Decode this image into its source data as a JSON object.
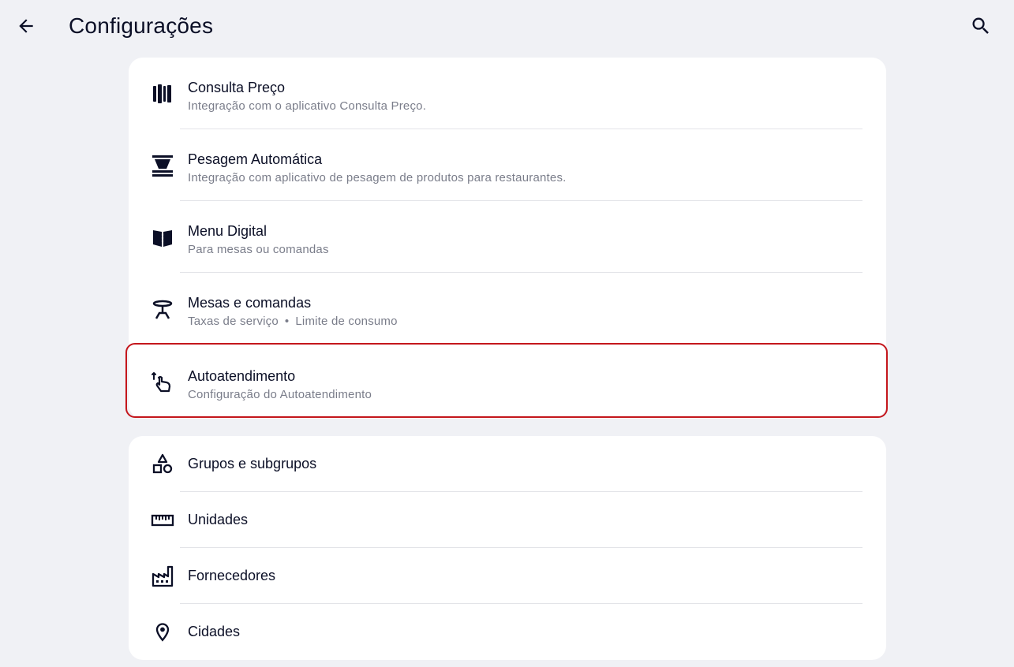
{
  "header": {
    "title": "Configurações"
  },
  "sections": {
    "integrations": [
      {
        "title": "Consulta Preço",
        "subtitle": "Integração com o aplicativo Consulta Preço."
      },
      {
        "title": "Pesagem Automática",
        "subtitle": "Integração com aplicativo de pesagem de produtos para restaurantes."
      },
      {
        "title": "Menu Digital",
        "subtitle": "Para mesas ou comandas"
      },
      {
        "title": "Mesas e comandas",
        "subtitle_parts": [
          "Taxas de serviço",
          "•",
          "Limite de consumo"
        ]
      },
      {
        "title": "Autoatendimento",
        "subtitle": "Configuração do Autoatendimento"
      }
    ],
    "registers": [
      {
        "title": "Grupos e subgrupos"
      },
      {
        "title": "Unidades"
      },
      {
        "title": "Fornecedores"
      },
      {
        "title": "Cidades"
      }
    ]
  },
  "colors": {
    "background": "#f0f1f5",
    "card": "#ffffff",
    "text": "#0b0f26",
    "subtext": "#7a7d8a",
    "highlight": "#c4161c"
  }
}
